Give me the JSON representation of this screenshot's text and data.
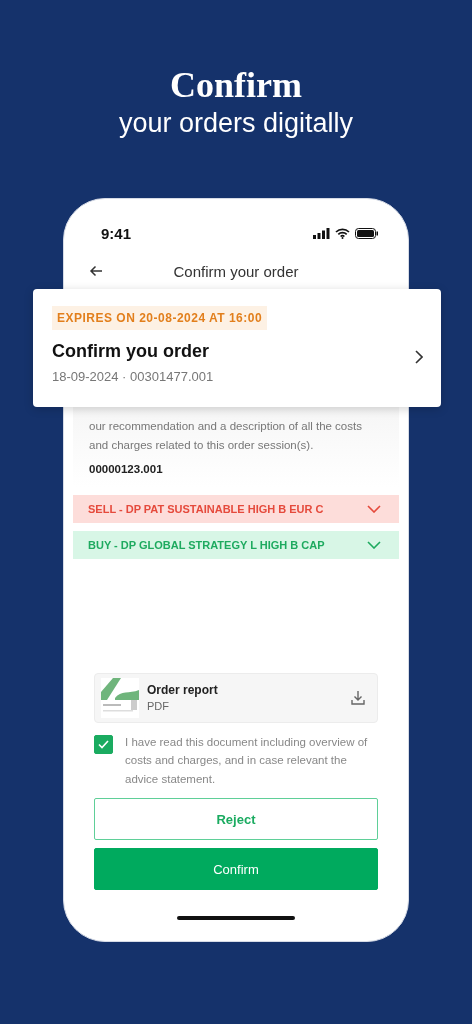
{
  "headline": {
    "title": "Confirm",
    "subtitle": "your orders digitally"
  },
  "status_bar": {
    "time": "9:41"
  },
  "header": {
    "title": "Confirm your order"
  },
  "order_card": {
    "badge": "EXPIRES ON 20-08-2024 AT 16:00",
    "title": "Confirm you order",
    "meta": "18-09-2024 · 00301477.001"
  },
  "description": {
    "lines": [
      "our recommendation and a description of all the costs",
      "and charges related to this order session(s)."
    ],
    "reference": "00000123.001"
  },
  "orders": [
    {
      "kind": "sell",
      "label": "SELL - DP PAT SUSTAINABLE HIGH B EUR C",
      "expanded": false
    },
    {
      "kind": "buy",
      "label": "BUY - DP GLOBAL STRATEGY L HIGH B CAP",
      "expanded": false
    }
  ],
  "document": {
    "title": "Order report",
    "type": "PDF"
  },
  "consent": {
    "checked": true,
    "text": "I have read this document including overview of costs and charges, and in case relevant the advice statement."
  },
  "buttons": [
    {
      "kind": "secondary",
      "label": "Reject"
    },
    {
      "kind": "primary",
      "label": "Confirm"
    }
  ]
}
